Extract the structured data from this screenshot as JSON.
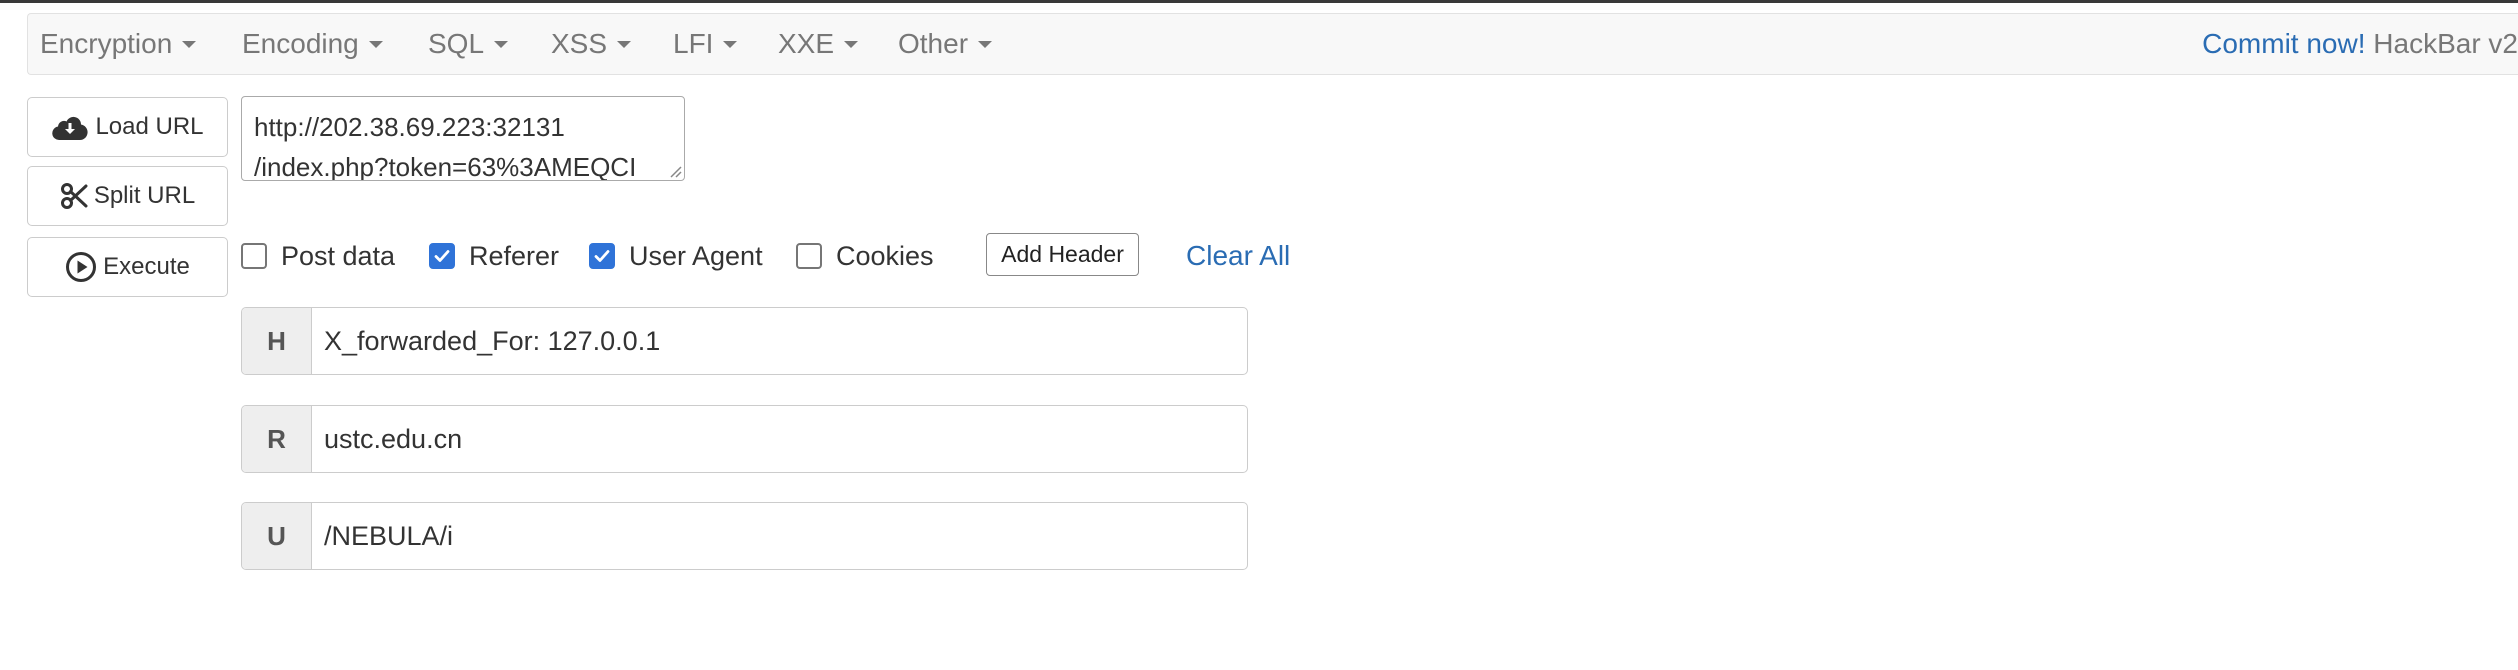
{
  "menu": {
    "items": [
      {
        "label": "Encryption"
      },
      {
        "label": "Encoding"
      },
      {
        "label": "SQL"
      },
      {
        "label": "XSS"
      },
      {
        "label": "LFI"
      },
      {
        "label": "XXE"
      },
      {
        "label": "Other"
      }
    ],
    "commit_label": "Commit now!",
    "brand_label": "HackBar v2"
  },
  "buttons": {
    "load_url": {
      "label": "Load URL",
      "icon": "cloud-download-icon"
    },
    "split_url": {
      "label": "Split URL",
      "icon": "scissors-icon"
    },
    "execute": {
      "label": "Execute",
      "icon": "play-circle-icon"
    }
  },
  "url": {
    "line1": "http://202.38.69.223:32131",
    "line2": "/index.php?token=63%3AMEQCI"
  },
  "options": {
    "post_data": {
      "label": "Post data",
      "checked": false
    },
    "referer": {
      "label": "Referer",
      "checked": true
    },
    "user_agent": {
      "label": "User Agent",
      "checked": true
    },
    "cookies": {
      "label": "Cookies",
      "checked": false
    },
    "add_header_label": "Add Header",
    "clear_all_label": "Clear All"
  },
  "rows": [
    {
      "prefix": "H",
      "value": "X_forwarded_For: 127.0.0.1"
    },
    {
      "prefix": "R",
      "value": "ustc.edu.cn"
    },
    {
      "prefix": "U",
      "value": "/NEBULA/i"
    }
  ],
  "colors": {
    "link": "#2a6cb3",
    "checkbox_checked": "#2f73d8",
    "menu_text": "#777777"
  }
}
